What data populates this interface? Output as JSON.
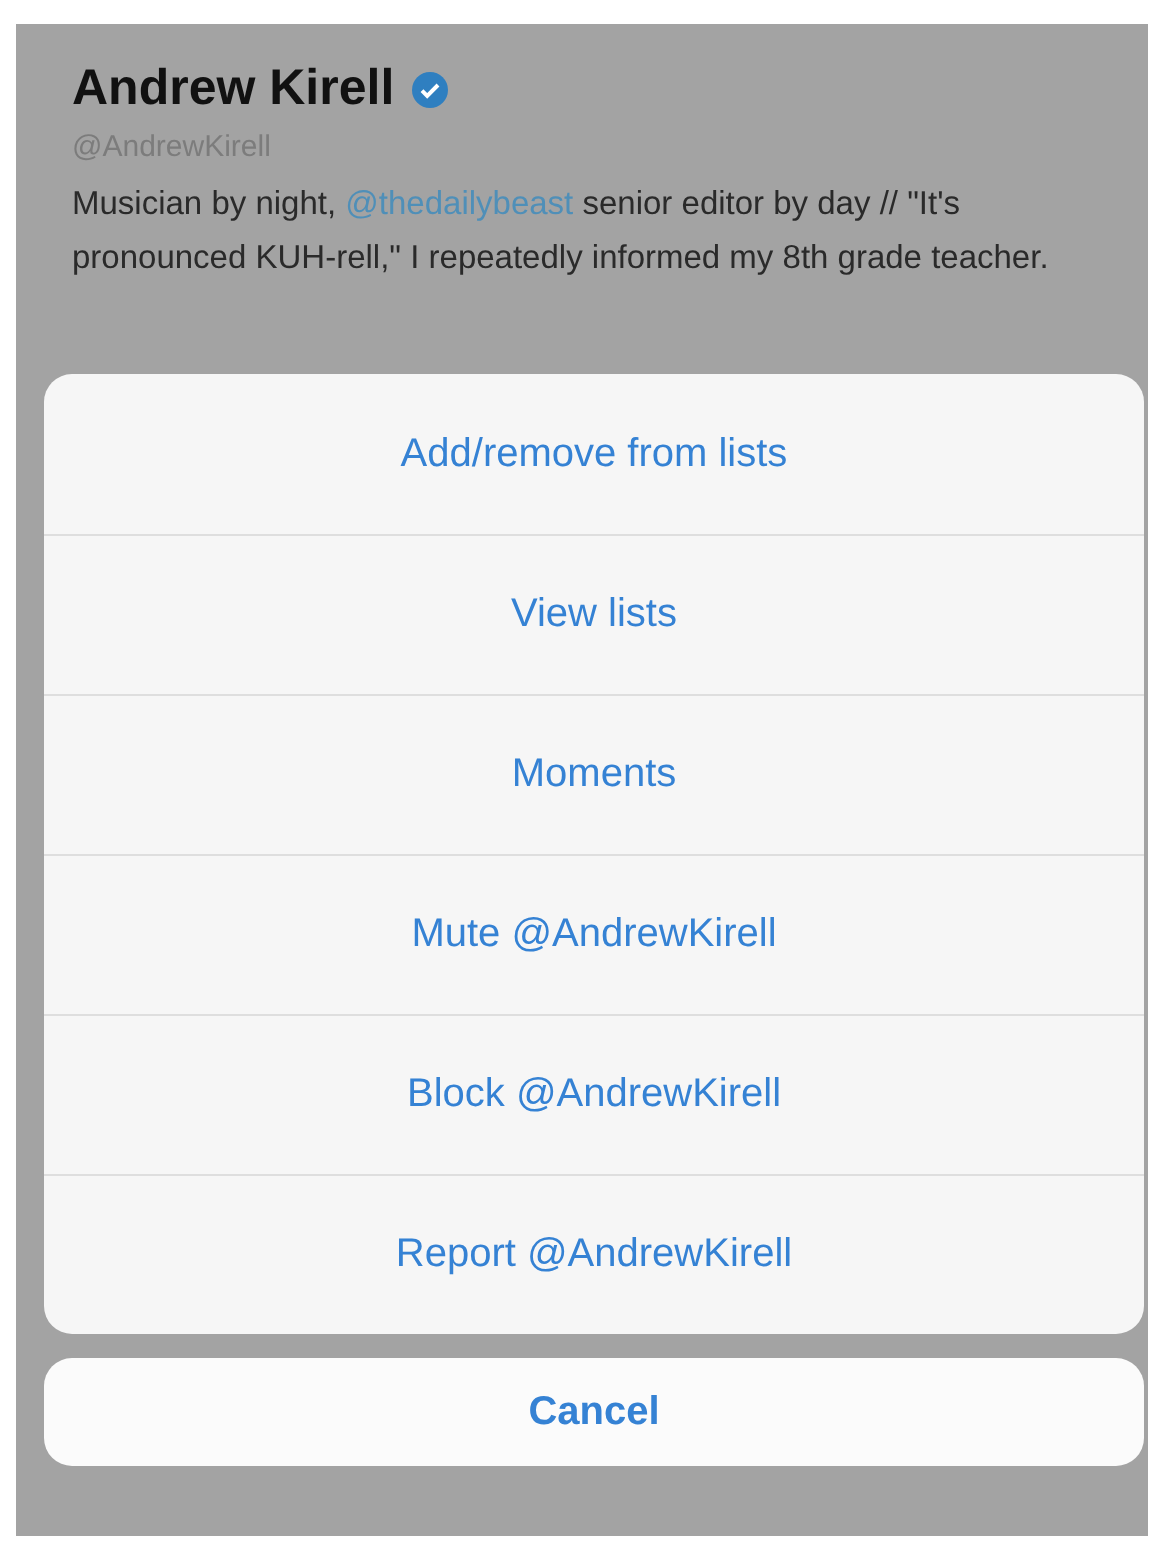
{
  "profile": {
    "name": "Andrew Kirell",
    "verified": true,
    "handle": "@AndrewKirell",
    "bio": {
      "before": "Musician by night, ",
      "mention": "@thedailybeast",
      "after": " senior editor by day // \"It's pronounced KUH-rell,\" I repeatedly informed my 8th grade teacher."
    }
  },
  "action_sheet": {
    "actions": [
      {
        "label": "Add/remove from lists"
      },
      {
        "label": "View lists"
      },
      {
        "label": "Moments"
      },
      {
        "label": "Mute @AndrewKirell"
      },
      {
        "label": "Block @AndrewKirell"
      },
      {
        "label": "Report @AndrewKirell"
      }
    ],
    "cancel": "Cancel"
  }
}
